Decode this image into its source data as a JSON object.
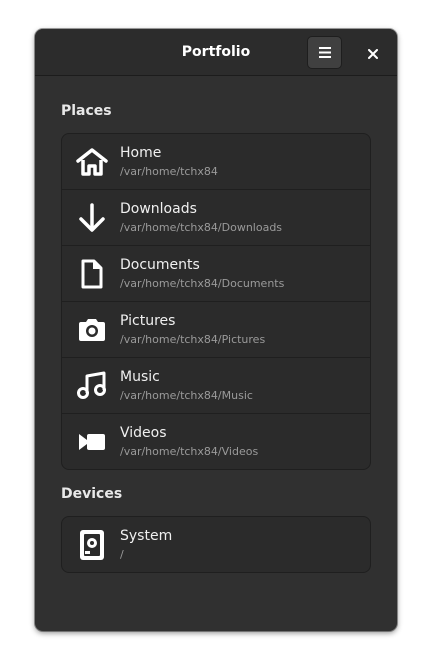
{
  "window": {
    "title": "Portfolio"
  },
  "header": {
    "menu_icon": "hamburger-menu-icon",
    "close_icon": "close-icon"
  },
  "places": {
    "title": "Places",
    "items": [
      {
        "name": "Home",
        "path": "/var/home/tchx84",
        "icon": "home-icon"
      },
      {
        "name": "Downloads",
        "path": "/var/home/tchx84/Downloads",
        "icon": "download-arrow-icon"
      },
      {
        "name": "Documents",
        "path": "/var/home/tchx84/Documents",
        "icon": "document-icon"
      },
      {
        "name": "Pictures",
        "path": "/var/home/tchx84/Pictures",
        "icon": "camera-icon"
      },
      {
        "name": "Music",
        "path": "/var/home/tchx84/Music",
        "icon": "music-note-icon"
      },
      {
        "name": "Videos",
        "path": "/var/home/tchx84/Videos",
        "icon": "video-camera-icon"
      }
    ]
  },
  "devices": {
    "title": "Devices",
    "items": [
      {
        "name": "System",
        "path": "/",
        "icon": "hard-drive-icon"
      }
    ]
  },
  "colors": {
    "window_bg": "#303030",
    "header_bg": "#2c2c2c",
    "list_bg": "#2b2b2b",
    "text_primary": "#f0f0f0",
    "text_secondary": "#9a9a9a"
  }
}
